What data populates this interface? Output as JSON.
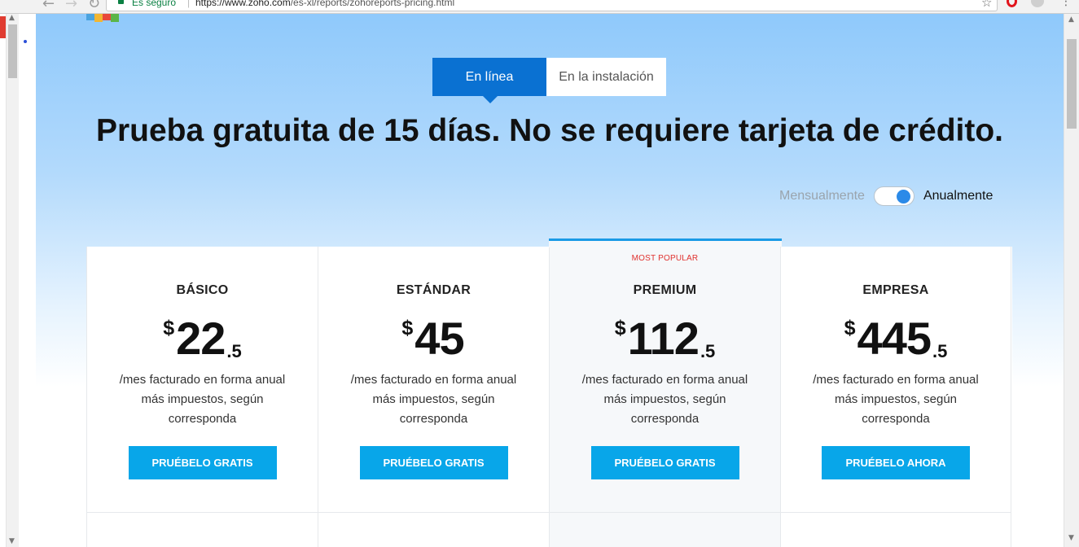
{
  "browser": {
    "secure_label": "Es seguro",
    "url_host": "https://www.zoho.com",
    "url_path": "/es-xl/reports/zohoreports-pricing.html",
    "back_icon": "arrow-left-icon",
    "forward_icon": "arrow-right-icon",
    "reload_icon": "reload-icon",
    "bookmark_icon": "star-icon",
    "menu_icon": "kebab-menu-icon"
  },
  "deployment_tabs": [
    {
      "label": "En línea",
      "active": true
    },
    {
      "label": "En la instalación",
      "active": false
    }
  ],
  "headline": "Prueba gratuita de 15 días. No se requiere tarjeta de crédito.",
  "billing": {
    "monthly_label": "Mensualmente",
    "annual_label": "Anualmente",
    "selected": "Anualmente"
  },
  "plans": [
    {
      "name": "BÁSICO",
      "currency": "$",
      "price_int": "22",
      "price_dec": ".5",
      "desc_line1": "/mes facturado en forma anual",
      "desc_line2": "más impuestos, según",
      "desc_line3": "corresponda",
      "cta": "PRUÉBELO GRATIS"
    },
    {
      "name": "ESTÁNDAR",
      "currency": "$",
      "price_int": "45",
      "price_dec": "",
      "desc_line1": "/mes facturado en forma anual",
      "desc_line2": "más impuestos, según",
      "desc_line3": "corresponda",
      "cta": "PRUÉBELO GRATIS"
    },
    {
      "name": "PREMIUM",
      "badge": "MOST POPULAR",
      "currency": "$",
      "price_int": "112",
      "price_dec": ".5",
      "desc_line1": "/mes facturado en forma anual",
      "desc_line2": "más impuestos, según",
      "desc_line3": "corresponda",
      "cta": "PRUÉBELO GRATIS"
    },
    {
      "name": "EMPRESA",
      "currency": "$",
      "price_int": "445",
      "price_dec": ".5",
      "desc_line1": "/mes facturado en forma anual",
      "desc_line2": "más impuestos, según",
      "desc_line3": "corresponda",
      "cta": "PRUÉBELO AHORA"
    }
  ],
  "colors": {
    "tab_active": "#0a71d2",
    "cta": "#08a6e9",
    "popular_accent": "#1a9ae6",
    "popular_badge": "#e0322f",
    "toggle_knob": "#2b8ae8"
  }
}
